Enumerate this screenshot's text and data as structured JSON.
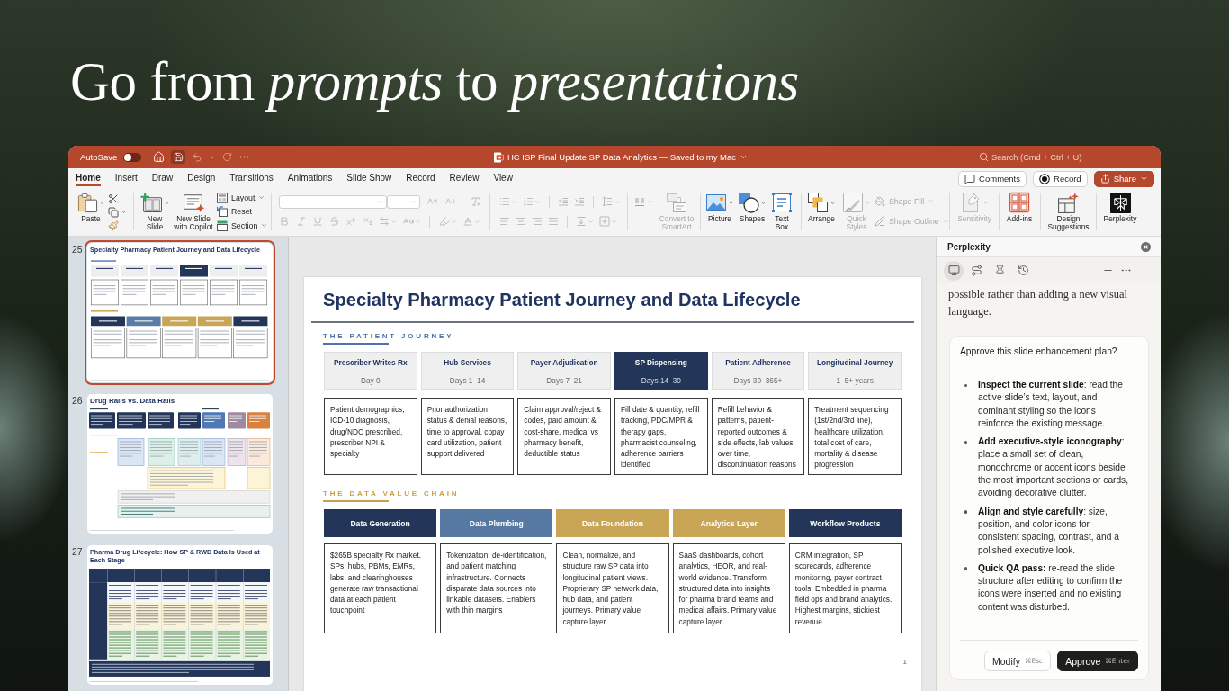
{
  "headline": "Go from *prompts* to *presentations*",
  "window": {
    "autosave": {
      "label": "AutoSave",
      "on": false
    },
    "title": "HC ISP Final Update SP Data Analytics — Saved to my Mac",
    "search": {
      "placeholder": "Search (Cmd + Ctrl + U)"
    }
  },
  "tabs": [
    {
      "label": "Home",
      "selected": true
    },
    {
      "label": "Insert",
      "selected": false
    },
    {
      "label": "Draw",
      "selected": false
    },
    {
      "label": "Design",
      "selected": false
    },
    {
      "label": "Transitions",
      "selected": false
    },
    {
      "label": "Animations",
      "selected": false
    },
    {
      "label": "Slide Show",
      "selected": false
    },
    {
      "label": "Record",
      "selected": false
    },
    {
      "label": "Review",
      "selected": false
    },
    {
      "label": "View",
      "selected": false
    }
  ],
  "header_buttons": [
    {
      "kind": "comments",
      "label": "Comments"
    },
    {
      "kind": "record",
      "label": "Record"
    },
    {
      "kind": "share",
      "label": "Share"
    }
  ],
  "ribbon": {
    "paste": {
      "label": "Paste"
    },
    "new_slide": {
      "label": "New Slide"
    },
    "new_slide_copilot": {
      "label": "New Slide with Copilot"
    },
    "slide_options": [
      {
        "label": "Layout"
      },
      {
        "label": "Reset"
      },
      {
        "label": "Section"
      }
    ],
    "font": {
      "disabled": true
    },
    "paragraph": {
      "disabled": true
    },
    "smartart": {
      "label": "Convert to SmartArt",
      "disabled": true
    },
    "insert": [
      {
        "label": "Picture"
      },
      {
        "label": "Shapes"
      },
      {
        "label": "Text Box"
      }
    ],
    "arrange": {
      "label": "Arrange"
    },
    "quick_styles": {
      "label": "Quick Styles",
      "disabled": true
    },
    "shape_format": [
      {
        "label": "Shape Fill",
        "disabled": true
      },
      {
        "label": "Shape Outline",
        "disabled": true
      }
    ],
    "sensitivity": {
      "label": "Sensitivity",
      "disabled": true
    },
    "add_ins": {
      "label": "Add-ins"
    },
    "design_suggestions": {
      "label": "Design Suggestions"
    },
    "perplexity": {
      "label": "Perplexity"
    }
  },
  "slides": [
    {
      "number": "25",
      "title": "Specialty Pharmacy Patient Journey and Data Lifecycle",
      "kind": "journey",
      "selected": true
    },
    {
      "number": "26",
      "title": "Drug Rails vs. Data Rails",
      "kind": "rails",
      "selected": false
    },
    {
      "number": "27",
      "title": "Pharma Drug Lifecycle: How SP & RWD Data Is Used at Each Stage",
      "kind": "lifecycle",
      "selected": false
    }
  ],
  "slide": {
    "title": "Specialty Pharmacy Patient Journey and Data Lifecycle",
    "journey": {
      "heading": "THE PATIENT JOURNEY",
      "steps": [
        {
          "title": "Prescriber Writes Rx",
          "timing": "Day 0",
          "description": "Patient demographics, ICD-10 diagnosis, drug/NDC prescribed, prescriber NPI & specialty",
          "selected": false
        },
        {
          "title": "Hub Services",
          "timing": "Days 1–14",
          "description": "Prior authorization status & denial reasons, time to approval, copay card utilization, patient support delivered",
          "selected": false
        },
        {
          "title": "Payer Adjudication",
          "timing": "Days 7–21",
          "description": "Claim approval/reject & codes, paid amount & cost-share, medical vs pharmacy benefit, deductible status",
          "selected": false
        },
        {
          "title": "SP Dispensing",
          "timing": "Days 14–30",
          "description": "Fill date & quantity, refill tracking, PDC/MPR & therapy gaps, pharmacist counseling, adherence barriers identified",
          "selected": true
        },
        {
          "title": "Patient Adherence",
          "timing": "Days 30–365+",
          "description": "Refill behavior & patterns, patient-reported outcomes & side effects, lab values over time, discontinuation reasons",
          "selected": false
        },
        {
          "title": "Longitudinal Journey",
          "timing": "1–5+ years",
          "description": "Treatment sequencing (1st/2nd/3rd line), healthcare utilization, total cost of care, mortality & disease progression",
          "selected": false
        }
      ]
    },
    "value_chain": {
      "heading": "THE DATA VALUE CHAIN",
      "stages": [
        {
          "title": "Data Generation",
          "color": "#233559",
          "description": "$265B specialty Rx market. SPs, hubs, PBMs, EMRs, labs, and clearinghouses generate raw transactional data at each patient touchpoint"
        },
        {
          "title": "Data Plumbing",
          "color": "#5679a3",
          "description": "Tokenization, de-identification, and patient matching infrastructure. Connects disparate data sources into linkable datasets. Enablers with thin margins"
        },
        {
          "title": "Data Foundation",
          "color": "#c8a655",
          "description": "Clean, normalize, and structure raw SP data into longitudinal patient views. Proprietary SP network data, hub data, and patient journeys. Primary value capture layer"
        },
        {
          "title": "Analytics Layer",
          "color": "#c8a655",
          "description": "SaaS dashboards, cohort analytics, HEOR, and real-world evidence. Transform structured data into insights for pharma brand teams and medical affairs. Primary value capture layer"
        },
        {
          "title": "Workflow Products",
          "color": "#233559",
          "description": "CRM integration, SP scorecards, adherence monitoring, payer contract tools. Embedded in pharma field ops and brand analytics. Highest margins, stickiest revenue"
        }
      ]
    },
    "page_number": "1"
  },
  "perplexity": {
    "title": "Perplexity",
    "mode_tabs": [
      {
        "selected": true
      },
      {
        "selected": false
      },
      {
        "selected": false
      },
      {
        "selected": false
      }
    ],
    "message": "possible rather than adding a new visual language.",
    "plan": {
      "question": "Approve this slide enhancement plan?",
      "steps": [
        "**Inspect the current slide**: read the active slide’s text, layout, and dominant styling so the icons reinforce the existing message.",
        "**Add executive-style iconography**: place a small set of clean, monochrome or accent icons beside the most important sections or cards, avoiding decorative clutter.",
        "**Align and style carefully**: size, position, and color icons for consistent spacing, contrast, and a polished executive look.",
        "**Quick QA pass:** re-read the slide structure after editing to confirm the icons were inserted and no existing content was disturbed."
      ],
      "actions": [
        {
          "kind": "secondary",
          "label": "Modify",
          "shortcut": "⌘Esc"
        },
        {
          "kind": "primary",
          "label": "Approve",
          "shortcut": "⌘Enter"
        }
      ]
    }
  }
}
